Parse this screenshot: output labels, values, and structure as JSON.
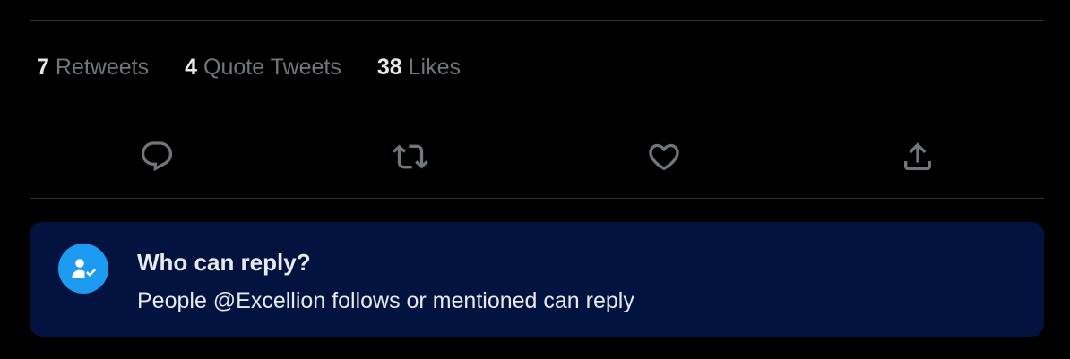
{
  "stats": {
    "retweets": {
      "count": "7",
      "label": "Retweets"
    },
    "quotes": {
      "count": "4",
      "label": "Quote Tweets"
    },
    "likes": {
      "count": "38",
      "label": "Likes"
    }
  },
  "actions": [
    {
      "name": "reply",
      "icon": "reply-bubble-icon"
    },
    {
      "name": "retweet",
      "icon": "retweet-icon"
    },
    {
      "name": "like",
      "icon": "heart-icon"
    },
    {
      "name": "share",
      "icon": "share-upload-icon"
    }
  ],
  "reply_settings": {
    "icon": "person-check-icon",
    "title": "Who can reply?",
    "description": "People @Excellion follows or mentioned can reply"
  },
  "colors": {
    "background": "#000000",
    "divider": "#2f3336",
    "muted_text": "#71767b",
    "primary_text": "#e7e9ea",
    "reply_box_bg": "#031340",
    "accent": "#1d9bf0"
  }
}
